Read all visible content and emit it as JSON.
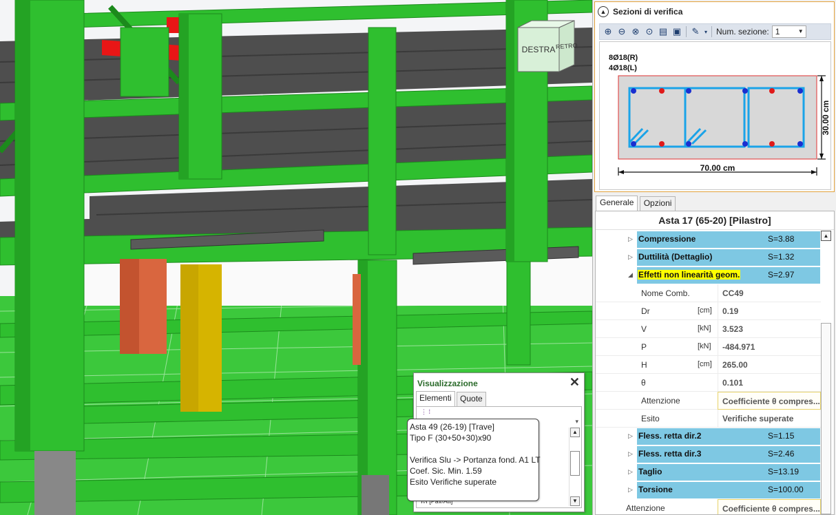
{
  "section_panel": {
    "title": "Sezioni di verifica",
    "num_label": "Num. sezione:",
    "num_value": "1",
    "rebar_top": "8Ø18(R)",
    "rebar_bottom": "4Ø18(L)",
    "height_dim": "30.00 cm",
    "width_dim": "70.00 cm"
  },
  "tabs": [
    "Generale",
    "Opzioni"
  ],
  "props": {
    "title": "Asta 17 (65-20) [Pilastro]",
    "groups_top": [
      {
        "name": "Compressione",
        "value": "S=3.88",
        "expanded": false
      },
      {
        "name": "Duttilità (Dettaglio)",
        "value": "S=1.32",
        "expanded": false
      }
    ],
    "group_open": {
      "name": "Effetti non linearità geom.",
      "value": "S=2.97"
    },
    "rows": [
      {
        "name": "Nome Comb.",
        "unit": "",
        "value": "CC49"
      },
      {
        "name": "Dr",
        "unit": "[cm]",
        "value": "0.19"
      },
      {
        "name": "V",
        "unit": "[kN]",
        "value": "3.523"
      },
      {
        "name": "P",
        "unit": "[kN]",
        "value": "-484.971"
      },
      {
        "name": "H",
        "unit": "[cm]",
        "value": "265.00"
      },
      {
        "name": "θ",
        "unit": "",
        "value": "0.101"
      },
      {
        "name": "Attenzione",
        "unit": "",
        "value": "Coefficiente θ compres..."
      },
      {
        "name": "Esito",
        "unit": "",
        "value": "Verifiche superate"
      }
    ],
    "groups_bottom": [
      {
        "name": "Fless. retta dir.2",
        "value": "S=1.15"
      },
      {
        "name": "Fless. retta dir.3",
        "value": "S=2.46"
      },
      {
        "name": "Taglio",
        "value": "S=13.19"
      },
      {
        "name": "Torsione",
        "value": "S=100.00"
      }
    ],
    "last_row": {
      "name": "Attenzione",
      "value": "Coefficiente θ compres..."
    }
  },
  "navcube": {
    "front": "DESTRA",
    "side": "RETRO"
  },
  "visualizzazione": {
    "title": "Visualizzazione",
    "tabs": [
      "Elementi",
      "Quote"
    ],
    "bottom_row": "Ⅰ◊Ⅰ [Pav/Att]"
  },
  "tooltip": {
    "lines": [
      "Asta 49 (26-19) [Trave]",
      "Tipo F (30+50+30)x90",
      "",
      "Verifica Slu -> Portanza fond. A1 LT",
      "Coef. Sic. Min. 1.59",
      "Esito Verifiche superate"
    ]
  },
  "colors": {
    "structure_green": "#2fbf2f",
    "dark_green": "#1c8a1c",
    "slab": "#505050",
    "section_highlight": "#7ec8e3",
    "panel_accent": "#e2a13a",
    "rebar_blue": "#1a2fd0",
    "rebar_red": "#e01a1a",
    "stirrup": "#1aa3e8"
  }
}
